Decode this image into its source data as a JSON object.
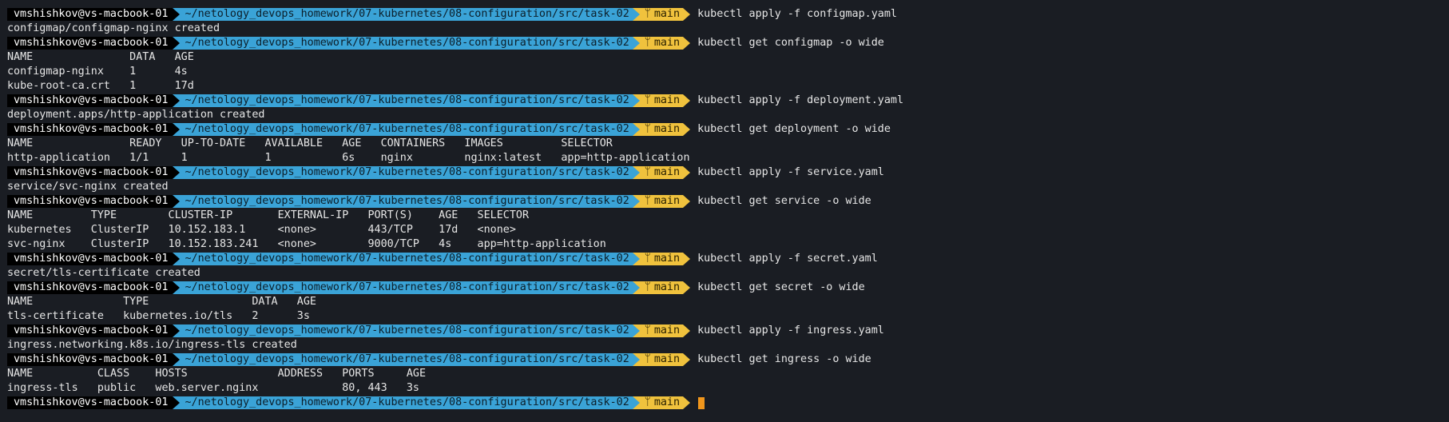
{
  "prompt": {
    "user_host": "vmshishkov@vs-macbook-01",
    "path": "~/netology_devops_homework/07-kubernetes/08-configuration/src/task-02",
    "branch": "main",
    "branch_icon": "git-branch-icon",
    "cursor_color": "#f0961c"
  },
  "lines": [
    {
      "type": "prompt",
      "command": "kubectl apply -f configmap.yaml"
    },
    {
      "type": "output",
      "text": "configmap/configmap-nginx created"
    },
    {
      "type": "prompt",
      "command": "kubectl get configmap -o wide"
    },
    {
      "type": "output",
      "text": "NAME               DATA   AGE"
    },
    {
      "type": "output",
      "text": "configmap-nginx    1      4s"
    },
    {
      "type": "output",
      "text": "kube-root-ca.crt   1      17d"
    },
    {
      "type": "prompt",
      "command": "kubectl apply -f deployment.yaml"
    },
    {
      "type": "output",
      "text": "deployment.apps/http-application created"
    },
    {
      "type": "prompt",
      "command": "kubectl get deployment -o wide"
    },
    {
      "type": "output",
      "text": "NAME               READY   UP-TO-DATE   AVAILABLE   AGE   CONTAINERS   IMAGES         SELECTOR"
    },
    {
      "type": "output",
      "text": "http-application   1/1     1            1           6s    nginx        nginx:latest   app=http-application"
    },
    {
      "type": "prompt",
      "command": "kubectl apply -f service.yaml"
    },
    {
      "type": "output",
      "text": "service/svc-nginx created"
    },
    {
      "type": "prompt",
      "command": "kubectl get service -o wide"
    },
    {
      "type": "output",
      "text": "NAME         TYPE        CLUSTER-IP       EXTERNAL-IP   PORT(S)    AGE   SELECTOR"
    },
    {
      "type": "output",
      "text": "kubernetes   ClusterIP   10.152.183.1     <none>        443/TCP    17d   <none>"
    },
    {
      "type": "output",
      "text": "svc-nginx    ClusterIP   10.152.183.241   <none>        9000/TCP   4s    app=http-application"
    },
    {
      "type": "prompt",
      "command": "kubectl apply -f secret.yaml"
    },
    {
      "type": "output",
      "text": "secret/tls-certificate created"
    },
    {
      "type": "prompt",
      "command": "kubectl get secret -o wide"
    },
    {
      "type": "output",
      "text": "NAME              TYPE                DATA   AGE"
    },
    {
      "type": "output",
      "text": "tls-certificate   kubernetes.io/tls   2      3s"
    },
    {
      "type": "prompt",
      "command": "kubectl apply -f ingress.yaml"
    },
    {
      "type": "output",
      "text": "ingress.networking.k8s.io/ingress-tls created"
    },
    {
      "type": "prompt",
      "command": "kubectl get ingress -o wide"
    },
    {
      "type": "output",
      "text": "NAME          CLASS    HOSTS              ADDRESS   PORTS     AGE"
    },
    {
      "type": "output",
      "text": "ingress-tls   public   web.server.nginx             80, 443   3s"
    },
    {
      "type": "prompt",
      "command": "",
      "cursor": true
    }
  ]
}
